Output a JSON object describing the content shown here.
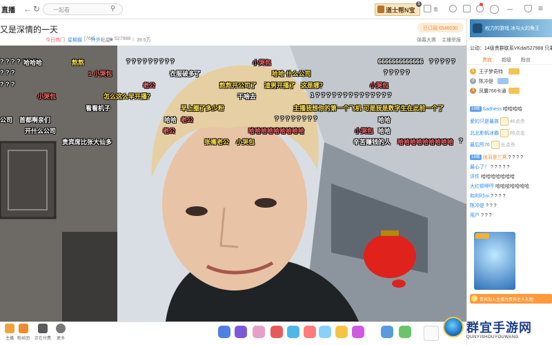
{
  "nav": {
    "logo": "直播",
    "search_placeholder": "一起看",
    "promo_label": "道士帮N宝",
    "promo_badge": "1",
    "messages_label": "看",
    "history_label": "历",
    "red_badge_count": "2"
  },
  "room": {
    "title": "又是深情的一天",
    "meta_hot": "今日热门",
    "meta_owner": "星期猫",
    "meta_level": "[766]",
    "meta_fans_label": "粘星",
    "meta_dropdown": "户外",
    "meta_viewers": "527988",
    "meta_followers": "39.5万",
    "follow_button": "已订阅  6546030",
    "report_label": "截图/录屏",
    "full_label": "全屏",
    "toggle_label": "弹幕大赛",
    "report2_label": "主播举报"
  },
  "danmaku": [
    {
      "text": "? ? ? ? ? ? ?",
      "color": "#ffffff"
    },
    {
      "text": "哈哈哈",
      "color": "#ffffff"
    },
    {
      "text": "熬熬",
      "color": "#ffe14d"
    },
    {
      "text": "? ? ? ? ? ? ? ? ?",
      "color": "#ffffff"
    },
    {
      "text": "小哭包",
      "color": "#ff6b6b"
    },
    {
      "text": "6666666666666",
      "color": "#ffffff"
    },
    {
      "text": "? ? ? ? ?",
      "color": "#ffffff"
    },
    {
      "text": "1  小哭包",
      "color": "#ff6b6b"
    },
    {
      "text": "衣服破多了",
      "color": "#ffffff"
    },
    {
      "text": "哈哈  什么公司",
      "color": "#ffe14d"
    },
    {
      "text": "?  ?  ?  ? ?",
      "color": "#ffffff"
    },
    {
      "text": "老公",
      "color": "#ff6b6b"
    },
    {
      "text": "熬熬开公司了",
      "color": "#ffe14d"
    },
    {
      "text": "渣男开播了",
      "color": "#ffe14d"
    },
    {
      "text": "这是哪？",
      "color": "#ffe14d"
    },
    {
      "text": "小哭包",
      "color": "#ff6b6b"
    },
    {
      "text": "小哭包",
      "color": "#ff6b6b"
    },
    {
      "text": "怎么这么早开播？",
      "color": "#ffe14d"
    },
    {
      "text": "干啥去",
      "color": "#ffffff"
    },
    {
      "text": "1  ? ? ? ? ? ? ? ? ? ? ? ? ? ?",
      "color": "#ffffff"
    },
    {
      "text": "看看机子",
      "color": "#ffffff"
    },
    {
      "text": "早上圈了多少粉",
      "color": "#ffe14d"
    },
    {
      "text": "主播我想你的第一个飞机 可是我是数字生在此前一个了",
      "color": "#ffe14d"
    },
    {
      "text": "公司",
      "color": "#ffffff"
    },
    {
      "text": "哈哈",
      "color": "#ffffff"
    },
    {
      "text": "老公",
      "color": "#ff6b6b"
    },
    {
      "text": "? ? ? ? ? ? ? ?",
      "color": "#ffffff"
    },
    {
      "text": "首都啊亲们",
      "color": "#ffffff"
    },
    {
      "text": "开什么公司",
      "color": "#ffffff"
    },
    {
      "text": "老公",
      "color": "#ff6b6b"
    },
    {
      "text": "哈哈哈哈哈哈哈哈哈",
      "color": "#ff6b6b"
    },
    {
      "text": "小哭包",
      "color": "#ff6b6b"
    },
    {
      "text": "哈哈",
      "color": "#ffffff"
    },
    {
      "text": "贵宾席比张大仙多",
      "color": "#ffffff"
    },
    {
      "text": "张嘴老公",
      "color": "#ffe14d"
    },
    {
      "text": "小哭包",
      "color": "#ffe14d"
    },
    {
      "text": "辛苦赚钱的人",
      "color": "#ffffff"
    },
    {
      "text": "哈哈哈哈哈哈哈哈哈",
      "color": "#ff6b6b"
    },
    {
      "text": "哈哈",
      "color": "#ffffff"
    },
    {
      "text": "?",
      "color": "#ffffff"
    },
    {
      "text": "? ? ?",
      "color": "#ffffff"
    },
    {
      "text": "? ? ?",
      "color": "#ffffff"
    }
  ],
  "bottom": {
    "items": [
      {
        "label": "主播",
        "color": "#f2a23a"
      },
      {
        "label": "粉丝团",
        "color": "#f08a2c"
      },
      {
        "label": "正在付费",
        "color": "#5a5a5a"
      },
      {
        "label": "更多",
        "color": "#777777"
      }
    ],
    "gift_colors": [
      "#4f7fe0",
      "#7a5ad6",
      "#e6a0c8",
      "#e85a5a",
      "#4fb6e8",
      "#ff7a7a",
      "#8ad0ff",
      "#f5c542",
      "#d05ae0",
      "#5a9ae0",
      "#6ac56a"
    ]
  },
  "sidebar": {
    "banner_text": "权力的游戏  冰与火的角王",
    "fans_line": "公动：14级贵群联系VKdaI527988  只果",
    "tabs": [
      "贵宾",
      "超级",
      "粉丝"
    ],
    "ranking": [
      {
        "num": "1",
        "name": "王子梦奇特",
        "color": "#f2b233"
      },
      {
        "num": "2",
        "name": "陈冲是",
        "color": "#9aa7b5"
      },
      {
        "num": "3",
        "name": "凤囊766卡通",
        "color": "#d18a4a"
      }
    ],
    "chat": [
      {
        "level": "19级",
        "name": "Sadness",
        "text": "哈哈哈哈",
        "lvcolor": "#5aa0f0"
      },
      {
        "level": "",
        "name": "爱的只是暴族",
        "text": "46点杀",
        "lvcolor": "#f08a2c"
      },
      {
        "level": "",
        "name": "北北影帆冰霸",
        "text": "88点击",
        "lvcolor": "#f08a2c"
      },
      {
        "level": "",
        "name": "最后所76",
        "text": "长点杀",
        "lvcolor": "#f08a2c"
      },
      {
        "level": "16级",
        "name": "张羽是三冥",
        "text": "? ? ? ?",
        "lvcolor": "#5aa0f0"
      },
      {
        "level": "",
        "name": "最心了？",
        "text": "? ? ? ? ?",
        "lvcolor": "#5aa0f0"
      },
      {
        "level": "",
        "name": "评件",
        "text": "哈哈哈哈哈哈哈",
        "lvcolor": "#5aa0f0"
      },
      {
        "level": "",
        "name": "大红顿咿哼",
        "text": "哈哈哈哈哈哈哈",
        "lvcolor": "#5aa0f0"
      },
      {
        "level": "",
        "name": "和利时ioi",
        "text": "? ? ? ?",
        "lvcolor": "#5aa0f0"
      },
      {
        "level": "",
        "name": "陈冲是",
        "text": "? ? ?",
        "lvcolor": "#5aa0f0"
      },
      {
        "level": "",
        "name": "用户",
        "text": "? ? ?",
        "lvcolor": "#5aa0f0"
      }
    ],
    "gift_notice": "贵宾加入主播为贵宾主人礼物"
  },
  "watermark": {
    "title": "群宜手游网",
    "subtitle": "QUNYISHOUYOUWANG"
  }
}
